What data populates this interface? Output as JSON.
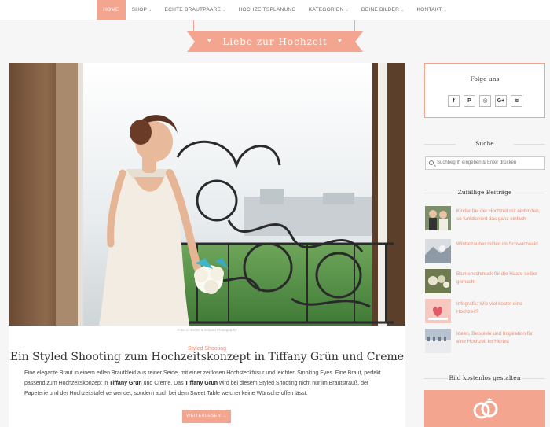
{
  "nav": {
    "items": [
      {
        "label": "HOME",
        "caret": false,
        "active": true
      },
      {
        "label": "SHOP",
        "caret": true,
        "active": false
      },
      {
        "label": "ECHTE BRAUTPAARE",
        "caret": true,
        "active": false
      },
      {
        "label": "HOCHZEITSPLANUNG",
        "caret": false,
        "active": false
      },
      {
        "label": "KATEGORIEN",
        "caret": true,
        "active": false
      },
      {
        "label": "DEINE BILDER",
        "caret": true,
        "active": false
      },
      {
        "label": "KONTAKT",
        "caret": true,
        "active": false
      }
    ],
    "caret_glyph": "⌄"
  },
  "header": {
    "site_title": "Liebe zur Hochzeit",
    "heart_glyph": "♥"
  },
  "post": {
    "photo_credit": "Foto: Christine & Eduard Photography",
    "category": "Styled Shooting",
    "title": "Ein Styled Shooting zum Hochzeitskonzept in Tiffany Grün und Creme",
    "excerpt": {
      "p1": "Eine elegante Braut in einem edlen Brautkleid aus reiner Seide, mit einer zeitlosen Hochsteckfrisur und leichten Smoking Eyes. Eine Braut, perfekt passend zum Hochzeitskonzept in ",
      "b1": "Tiffany Grün",
      "p2": " und Creme. Das ",
      "b2": "Tiffany Grün",
      "p3": " wird bei diesem Styled Shooting nicht nur im Brautstrauß, der Papeterie und der Hochzeitstafel verwendet, sondern auch bei dem Sweet Table welcher keine Wünsche offen lässt."
    },
    "read_more": "WEITERLESEN →"
  },
  "sidebar": {
    "follow_title": "Folge uns",
    "social": [
      {
        "label": "f",
        "icon": "facebook-icon"
      },
      {
        "label": "P",
        "icon": "pinterest-icon"
      },
      {
        "label": "◎",
        "icon": "instagram-icon"
      },
      {
        "label": "G+",
        "icon": "google-plus-icon"
      },
      {
        "label": "≋",
        "icon": "rss-icon"
      }
    ],
    "search_title": "Suche",
    "search_placeholder": "Suchbegriff eingeben & Enter drücken",
    "random_title": "Zufällige Beiträge",
    "random_posts": [
      {
        "title": "Kinder bei der Hochzeit mit einbinden, so funktioniert das ganz einfach"
      },
      {
        "title": "Winterzauber mitten im Schwarzwald"
      },
      {
        "title": "Blumenschmuck für die Haare selber gemacht"
      },
      {
        "title": "Infografik: Wie viel kostet eine Hochzeit?"
      },
      {
        "title": "Ideen, Beispiele und Inspiration für eine Hochzeit im Herbst"
      }
    ],
    "cta_title": "Bild kostenlos gestalten"
  },
  "colors": {
    "accent": "#f4a590",
    "accent_text": "#f08a6e"
  }
}
